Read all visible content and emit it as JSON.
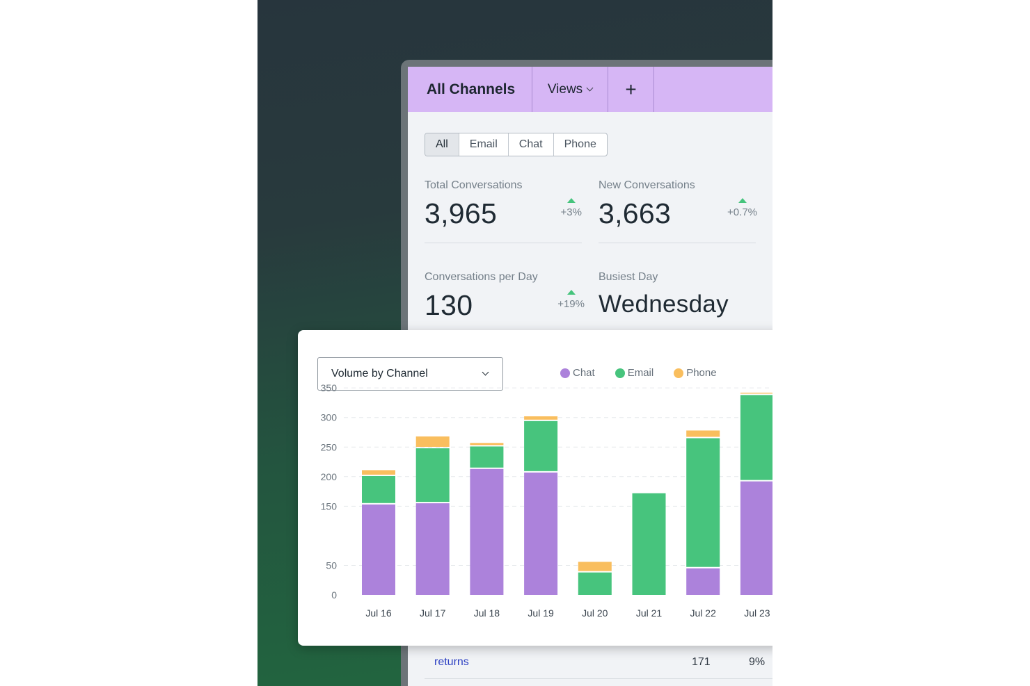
{
  "colors": {
    "chat": "#ac82db",
    "email": "#47c47d",
    "phone": "#f9be5e",
    "accent": "#d6b6f5"
  },
  "header": {
    "title": "All Channels",
    "views_label": "Views",
    "add_label": "+"
  },
  "channel_filter": {
    "options": [
      "All",
      "Email",
      "Chat",
      "Phone"
    ],
    "selected": "All"
  },
  "metrics": [
    {
      "label": "Total Conversations",
      "value": "3,965",
      "delta": "+3%"
    },
    {
      "label": "New Conversations",
      "value": "3,663",
      "delta": "+0.7%"
    },
    {
      "label": "Conversations per Day",
      "value": "130",
      "delta": "+19%"
    },
    {
      "label": "Busiest Day",
      "value": "Wednesday",
      "delta": ""
    }
  ],
  "chart_card": {
    "selector_label": "Volume by Channel"
  },
  "table_row": {
    "keyword": "returns",
    "count": "171",
    "percent": "9%"
  },
  "chart_data": {
    "type": "bar",
    "stacked": true,
    "categories": [
      "Jul 16",
      "Jul 17",
      "Jul 18",
      "Jul 19",
      "Jul 20",
      "Jul 21",
      "Jul 22",
      "Jul 23"
    ],
    "series": [
      {
        "name": "Chat",
        "values": [
          153,
          155,
          213,
          207,
          0,
          0,
          45,
          192
        ]
      },
      {
        "name": "Email",
        "values": [
          48,
          93,
          38,
          87,
          38,
          172,
          220,
          146
        ]
      },
      {
        "name": "Phone",
        "values": [
          10,
          20,
          6,
          8,
          18,
          0,
          13,
          4
        ]
      }
    ],
    "y_ticks": [
      350,
      300,
      250,
      200,
      150,
      50,
      0
    ],
    "legend": "top-right",
    "grid": true,
    "title": "",
    "xlabel": "",
    "ylabel": ""
  }
}
